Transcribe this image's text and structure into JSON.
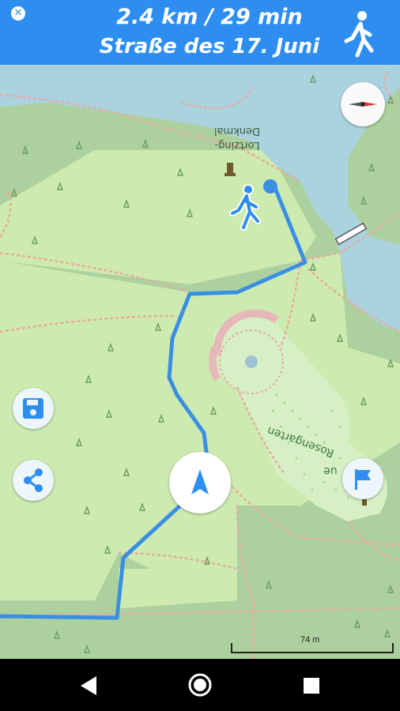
{
  "header": {
    "close_icon": "close-icon",
    "distance_time": "2.4 km / 29 min",
    "street": "Straße des 17. Juni",
    "mode_icon": "pedestrian-icon"
  },
  "map": {
    "labels": {
      "monument_line1": "Lortzing-",
      "monument_line2": "Denkmal",
      "rose_garden": "Rosengarten",
      "rose_garden_fragment": "ue"
    },
    "scale": "74 m",
    "route_color": "#3b8fe3",
    "park_color": "#add19e",
    "water_color": "#aad3df"
  },
  "controls": {
    "save_icon": "save-icon",
    "share_icon": "share-icon",
    "navigate_icon": "navigation-arrow-icon",
    "compass_icon": "compass-icon",
    "destination_icon": "flag-icon"
  },
  "navbar": {
    "back_icon": "back-icon",
    "home_icon": "home-icon",
    "recents_icon": "recents-icon"
  }
}
